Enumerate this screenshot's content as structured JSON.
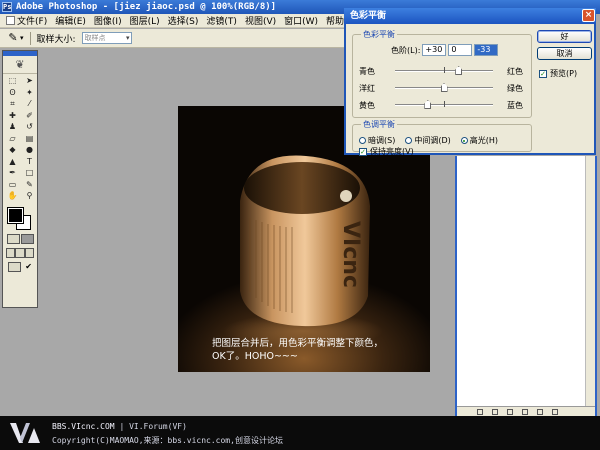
{
  "window": {
    "title": "Adobe Photoshop - [jiez  jiaoc.psd @ 100%(RGB/8)]"
  },
  "menubar": {
    "items": [
      "文件(F)",
      "编辑(E)",
      "图像(I)",
      "图层(L)",
      "选择(S)",
      "滤镜(T)",
      "视图(V)",
      "窗口(W)",
      "帮助(H)"
    ]
  },
  "options": {
    "sample_label": "取样大小:",
    "sample_value": "取样点"
  },
  "document": {
    "ring_text": "VIcnc",
    "caption_line1": "把图层合并后，用色彩平衡调整下颜色，",
    "caption_line2": "OK了。HOHO~~~"
  },
  "dialog": {
    "title": "色彩平衡",
    "close": "×",
    "balance_group_title": "色彩平衡",
    "levels_label": "色阶(L):",
    "levels": [
      "+30",
      "0",
      "-33"
    ],
    "sliders": [
      {
        "left": "青色",
        "right": "红色",
        "value": 30
      },
      {
        "left": "洋红",
        "right": "绿色",
        "value": 0
      },
      {
        "left": "黄色",
        "right": "蓝色",
        "value": -33
      }
    ],
    "tone_group_title": "色调平衡",
    "tones": [
      {
        "label": "暗调(S)",
        "selected": false
      },
      {
        "label": "中间调(D)",
        "selected": false
      },
      {
        "label": "高光(H)",
        "selected": true
      }
    ],
    "preserve_label": "保持亮度(V)",
    "preserve_checked": true,
    "ok_label": "好",
    "cancel_label": "取消",
    "preview_label": "预览(P)",
    "preview_checked": true
  },
  "footer": {
    "site": "BBS.VIcnc.COM",
    "forum": "VI.Forum(VF)",
    "copyright_line": "Copyright(C)MAOMAO,来源：bbs.vicnc.com,创意设计论坛"
  },
  "colors": {
    "titlebar": "#1f56b8",
    "foreground": "#000000",
    "background": "#ffffff"
  }
}
